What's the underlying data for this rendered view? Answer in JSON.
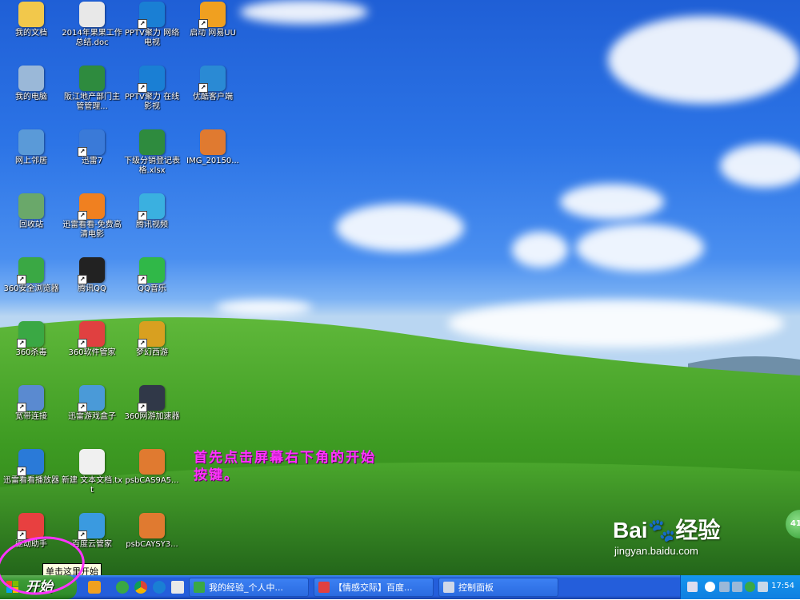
{
  "desktop": {
    "icons": [
      {
        "label": "我的文档",
        "color": "#f2c84b",
        "shortcut": false
      },
      {
        "label": "2014年果果工作总结.doc",
        "color": "#e8e8e8",
        "shortcut": false
      },
      {
        "label": "PPTV聚力 网络电视",
        "color": "#1a7fd4",
        "shortcut": true
      },
      {
        "label": "启动 网易UU",
        "color": "#f0a020",
        "shortcut": true
      },
      {
        "label": "我的电脑",
        "color": "#9ab8d8",
        "shortcut": false
      },
      {
        "label": "阪江地产部门主管管理...",
        "color": "#2e8b3e",
        "shortcut": false
      },
      {
        "label": "PPTV聚力 在线影视",
        "color": "#1a7fd4",
        "shortcut": true
      },
      {
        "label": "优酷客户端",
        "color": "#2a8ad4",
        "shortcut": true
      },
      {
        "label": "网上邻居",
        "color": "#5a9ad8",
        "shortcut": false
      },
      {
        "label": "迅雷7",
        "color": "#3a7ad8",
        "shortcut": true
      },
      {
        "label": "下级分销登记表格.xlsx",
        "color": "#2e8b3e",
        "shortcut": false
      },
      {
        "label": "IMG_20150...",
        "color": "#e07a30",
        "shortcut": false
      },
      {
        "label": "回收站",
        "color": "#6aa86a",
        "shortcut": false
      },
      {
        "label": "迅雷看看-免费高清电影",
        "color": "#f08020",
        "shortcut": true
      },
      {
        "label": "腾讯视频",
        "color": "#3ab0e0",
        "shortcut": true
      },
      {
        "label": "360安全浏览器",
        "color": "#3aa844",
        "shortcut": true
      },
      {
        "label": "腾讯QQ",
        "color": "#222222",
        "shortcut": true
      },
      {
        "label": "QQ音乐",
        "color": "#30b848",
        "shortcut": true
      },
      {
        "label": "360杀毒",
        "color": "#3aa844",
        "shortcut": true
      },
      {
        "label": "360软件管家",
        "color": "#e04040",
        "shortcut": true
      },
      {
        "label": "梦幻西游",
        "color": "#d8a020",
        "shortcut": true
      },
      {
        "label": "宽带连接",
        "color": "#5a8ad0",
        "shortcut": true
      },
      {
        "label": "迅雷游戏盒子",
        "color": "#4a9ad8",
        "shortcut": true
      },
      {
        "label": "360网游加速器",
        "color": "#303848",
        "shortcut": true
      },
      {
        "label": "迅雷看看播放器",
        "color": "#2a7ad8",
        "shortcut": true
      },
      {
        "label": "新建 文本文档.txt",
        "color": "#f0f0f0",
        "shortcut": false
      },
      {
        "label": "psbCAS9A5...",
        "color": "#e07a30",
        "shortcut": false
      },
      {
        "label": "驱动助手",
        "color": "#e84040",
        "shortcut": true
      },
      {
        "label": "百度云管家",
        "color": "#3a9ae0",
        "shortcut": true
      },
      {
        "label": "psbCAYSY3...",
        "color": "#e07a30",
        "shortcut": false
      }
    ],
    "annotation_lines": [
      "首先点击屏幕右下角的开始",
      "按键。"
    ]
  },
  "tooltip": "单击这里开始",
  "watermark": {
    "logo": "Bai🐾经验",
    "url": "jingyan.baidu.com"
  },
  "side_badge": "41",
  "taskbar": {
    "start_label": "开始",
    "tasks": [
      {
        "label": "我的经验_个人中...",
        "color": "#3aa844"
      },
      {
        "label": "【情感交际】百度...",
        "color": "#e04040"
      },
      {
        "label": "控制面板",
        "color": "#d0d8e8"
      }
    ],
    "clock": "17:54"
  }
}
